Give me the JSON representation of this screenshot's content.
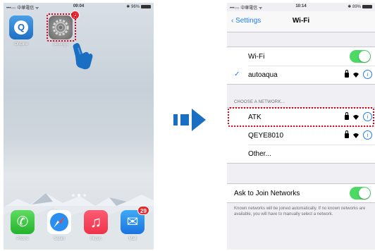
{
  "left_phone": {
    "status": {
      "carrier": "•••○○ 中華電信 ᯤ",
      "time": "09:04",
      "battery": "✱ 96%"
    },
    "apps": [
      {
        "label": "OnLine",
        "glyph": "Q"
      },
      {
        "label": "Settings",
        "badge": "1"
      }
    ],
    "dock": [
      {
        "label": "Phone",
        "glyph": "✆"
      },
      {
        "label": "Safari",
        "glyph": "✈"
      },
      {
        "label": "Music",
        "glyph": "♫"
      },
      {
        "label": "Mail",
        "glyph": "✉",
        "badge": "29"
      }
    ]
  },
  "right_phone": {
    "status": {
      "carrier": "•••○○ 中華電信 ᯤ",
      "time": "10:14",
      "battery": "✱ 89%"
    },
    "nav": {
      "back_label": "Settings",
      "title": "Wi-Fi"
    },
    "wifi_row": {
      "label": "Wi-Fi",
      "on": true
    },
    "connected": {
      "check": "✓",
      "name": "autoaqua"
    },
    "choose_header": "CHOOSE A NETWORK...",
    "networks": [
      {
        "name": "ATK"
      },
      {
        "name": "QEYE8010"
      },
      {
        "name": "Other..."
      }
    ],
    "ask_join": {
      "label": "Ask to Join Networks",
      "on": true
    },
    "footnote": "Known networks will be joined automatically. If no known networks are available, you will have to manually select a network."
  },
  "colors": {
    "accent": "#1e7cf2",
    "toggle_on": "#4cd964",
    "highlight": "#d0021b",
    "arrow": "#1a6fc2"
  }
}
